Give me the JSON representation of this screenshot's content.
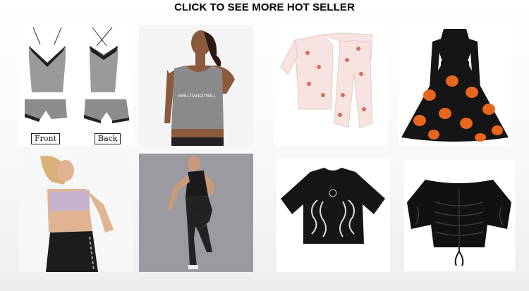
{
  "header": {
    "title": "CLICK TO SEE MORE HOT SELLER"
  },
  "products": [
    {
      "name": "lace-cami-shorts-set",
      "labels": [
        "Front",
        "Back"
      ]
    },
    {
      "name": "gray-sports-tank",
      "print": "#WILLITANDITWILL"
    },
    {
      "name": "printed-pajama-set"
    },
    {
      "name": "pumpkin-print-dress"
    },
    {
      "name": "lilac-sports-bra-set"
    },
    {
      "name": "black-activewear-set"
    },
    {
      "name": "dragon-print-crop-tee"
    },
    {
      "name": "satin-ruched-crop-top"
    }
  ],
  "colors": {
    "gray": "#8f8f8f",
    "black": "#151515",
    "orange": "#e8661d",
    "lilac": "#c8b3cf",
    "pink": "#f7e3df"
  }
}
